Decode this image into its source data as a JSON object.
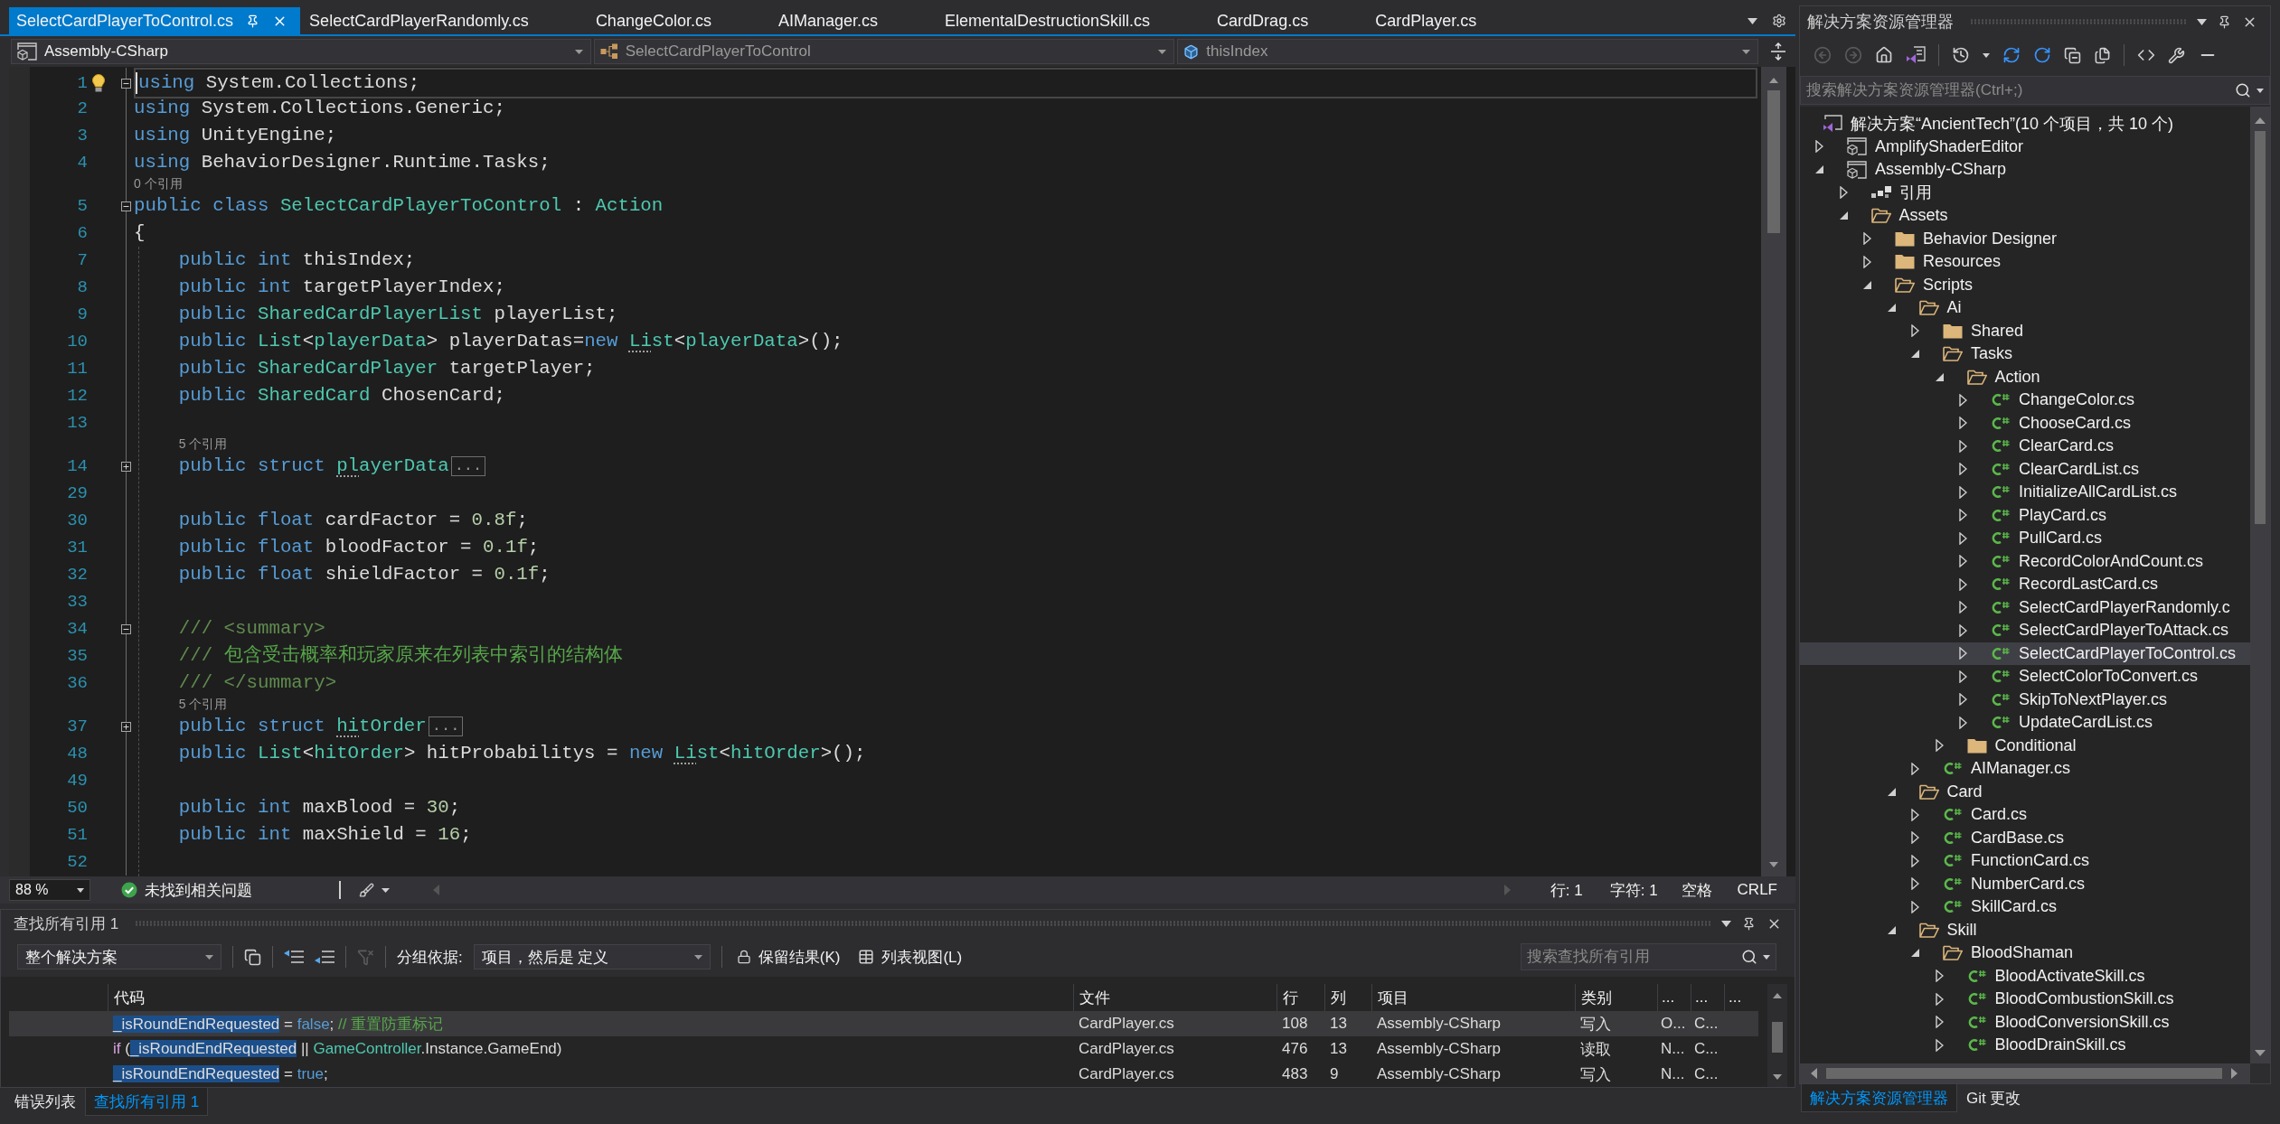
{
  "editor_tabs": [
    {
      "label": "SelectCardPlayerToControl.cs",
      "selected": true
    },
    {
      "label": "SelectCardPlayerRandomly.cs",
      "selected": false
    },
    {
      "label": "ChangeColor.cs",
      "selected": false
    },
    {
      "label": "AIManager.cs",
      "selected": false
    },
    {
      "label": "ElementalDestructionSkill.cs",
      "selected": false
    },
    {
      "label": "CardDrag.cs",
      "selected": false
    },
    {
      "label": "CardPlayer.cs",
      "selected": false
    }
  ],
  "nav_bar": {
    "project": "Assembly-CSharp",
    "type": "SelectCardPlayerToControl",
    "member": "thisIndex"
  },
  "editor": {
    "lines": [
      {
        "number": "1",
        "current": true,
        "folded": false,
        "tokens": [
          {
            "text": "using",
            "kind": "keyword"
          },
          {
            "text": " System.Collections;",
            "kind": "plain"
          }
        ]
      },
      {
        "number": "2",
        "current": false,
        "tokens": [
          {
            "text": "using",
            "kind": "keyword"
          },
          {
            "text": " System.Collections.Generic;",
            "kind": "plain"
          }
        ]
      },
      {
        "number": "3",
        "current": false,
        "tokens": [
          {
            "text": "using",
            "kind": "keyword"
          },
          {
            "text": " UnityEngine;",
            "kind": "plain"
          }
        ]
      },
      {
        "number": "4",
        "current": false,
        "tokens": [
          {
            "text": "using",
            "kind": "keyword"
          },
          {
            "text": " BehaviorDesigner.Runtime.Tasks;",
            "kind": "plain"
          }
        ]
      },
      {
        "number": "5",
        "current": false,
        "folded": false,
        "codelens": "0 个引用",
        "tokens": [
          {
            "text": "public class ",
            "kind": "keyword"
          },
          {
            "text": "SelectCardPlayerToControl",
            "kind": "type"
          },
          {
            "text": " : ",
            "kind": "plain"
          },
          {
            "text": "Action",
            "kind": "type"
          }
        ]
      },
      {
        "number": "6",
        "current": false,
        "tokens": [
          {
            "text": "{",
            "kind": "plain"
          }
        ]
      },
      {
        "number": "7",
        "current": false,
        "tokens": [
          {
            "text": "    public int ",
            "kind": "keyword"
          },
          {
            "text": "thisIndex;",
            "kind": "plain"
          }
        ]
      },
      {
        "number": "8",
        "current": false,
        "tokens": [
          {
            "text": "    public int ",
            "kind": "keyword"
          },
          {
            "text": "targetPlayerIndex;",
            "kind": "plain"
          }
        ]
      },
      {
        "number": "9",
        "current": false,
        "tokens": [
          {
            "text": "    public ",
            "kind": "keyword"
          },
          {
            "text": "SharedCardPlayerList",
            "kind": "type"
          },
          {
            "text": " playerList;",
            "kind": "plain"
          }
        ]
      },
      {
        "number": "10",
        "current": false,
        "tokens": [
          {
            "text": "    public ",
            "kind": "keyword"
          },
          {
            "text": "List",
            "kind": "type"
          },
          {
            "text": "<",
            "kind": "plain"
          },
          {
            "text": "playerData",
            "kind": "type"
          },
          {
            "text": "> playerDatas=",
            "kind": "plain"
          },
          {
            "text": "new ",
            "kind": "keyword"
          },
          {
            "text": "Li",
            "kind": "type",
            "hint": true
          },
          {
            "text": "st",
            "kind": "type"
          },
          {
            "text": "<",
            "kind": "plain"
          },
          {
            "text": "playerData",
            "kind": "type"
          },
          {
            "text": ">();",
            "kind": "plain"
          }
        ]
      },
      {
        "number": "11",
        "current": false,
        "tokens": [
          {
            "text": "    public ",
            "kind": "keyword"
          },
          {
            "text": "SharedCardPlayer",
            "kind": "type"
          },
          {
            "text": " targetPlayer;",
            "kind": "plain"
          }
        ]
      },
      {
        "number": "12",
        "current": false,
        "tokens": [
          {
            "text": "    public ",
            "kind": "keyword"
          },
          {
            "text": "SharedCard",
            "kind": "type"
          },
          {
            "text": " ChosenCard;",
            "kind": "plain"
          }
        ]
      },
      {
        "number": "13",
        "current": false
      },
      {
        "number": "14",
        "current": false,
        "folded": true,
        "codelens": "5 个引用",
        "tokens": [
          {
            "text": "    public struct ",
            "kind": "keyword"
          },
          {
            "text": "pl",
            "kind": "type",
            "hint": true
          },
          {
            "text": "ayerData",
            "kind": "type"
          }
        ],
        "collapsed_marker": "..."
      },
      {
        "number": "29",
        "current": false
      },
      {
        "number": "30",
        "current": false,
        "tokens": [
          {
            "text": "    public float ",
            "kind": "keyword"
          },
          {
            "text": "cardFactor = ",
            "kind": "plain"
          },
          {
            "text": "0.8f",
            "kind": "number"
          },
          {
            "text": ";",
            "kind": "plain"
          }
        ]
      },
      {
        "number": "31",
        "current": false,
        "tokens": [
          {
            "text": "    public float ",
            "kind": "keyword"
          },
          {
            "text": "bloodFactor = ",
            "kind": "plain"
          },
          {
            "text": "0.1f",
            "kind": "number"
          },
          {
            "text": ";",
            "kind": "plain"
          }
        ]
      },
      {
        "number": "32",
        "current": false,
        "tokens": [
          {
            "text": "    public float ",
            "kind": "keyword"
          },
          {
            "text": "shieldFactor = ",
            "kind": "plain"
          },
          {
            "text": "0.1f",
            "kind": "number"
          },
          {
            "text": ";",
            "kind": "plain"
          }
        ]
      },
      {
        "number": "33",
        "current": false
      },
      {
        "number": "34",
        "current": false,
        "folded": false,
        "tokens": [
          {
            "text": "    /// <summary>",
            "kind": "doc"
          }
        ]
      },
      {
        "number": "35",
        "current": false,
        "tokens": [
          {
            "text": "    /// ",
            "kind": "doc"
          },
          {
            "text": "包含受击概率和玩家原来在列表中索引的结构体",
            "kind": "comment"
          }
        ]
      },
      {
        "number": "36",
        "current": false,
        "tokens": [
          {
            "text": "    /// </summary>",
            "kind": "doc"
          }
        ]
      },
      {
        "number": "37",
        "current": false,
        "folded": true,
        "codelens": "5 个引用",
        "tokens": [
          {
            "text": "    public struct ",
            "kind": "keyword"
          },
          {
            "text": "hi",
            "kind": "type",
            "hint": true
          },
          {
            "text": "tOrder",
            "kind": "type"
          }
        ],
        "collapsed_marker": "..."
      },
      {
        "number": "48",
        "current": false,
        "tokens": [
          {
            "text": "    public ",
            "kind": "keyword"
          },
          {
            "text": "List",
            "kind": "type"
          },
          {
            "text": "<",
            "kind": "plain"
          },
          {
            "text": "hitOrder",
            "kind": "type"
          },
          {
            "text": "> hitProbabilitys = ",
            "kind": "plain"
          },
          {
            "text": "new ",
            "kind": "keyword"
          },
          {
            "text": "Li",
            "kind": "type",
            "hint": true
          },
          {
            "text": "st",
            "kind": "type"
          },
          {
            "text": "<",
            "kind": "plain"
          },
          {
            "text": "hitOrder",
            "kind": "type"
          },
          {
            "text": ">();",
            "kind": "plain"
          }
        ]
      },
      {
        "number": "49",
        "current": false
      },
      {
        "number": "50",
        "current": false,
        "tokens": [
          {
            "text": "    public int ",
            "kind": "keyword"
          },
          {
            "text": "maxBlood = ",
            "kind": "plain"
          },
          {
            "text": "30",
            "kind": "number"
          },
          {
            "text": ";",
            "kind": "plain"
          }
        ]
      },
      {
        "number": "51",
        "current": false,
        "tokens": [
          {
            "text": "    public int ",
            "kind": "keyword"
          },
          {
            "text": "maxShield = ",
            "kind": "plain"
          },
          {
            "text": "16",
            "kind": "number"
          },
          {
            "text": ";",
            "kind": "plain"
          }
        ]
      },
      {
        "number": "52",
        "current": false
      }
    ]
  },
  "editor_status": {
    "zoom": "88 %",
    "issues": "未找到相关问题",
    "line": "行: 1",
    "column": "字符: 1",
    "indent": "空格",
    "line_ending": "CRLF"
  },
  "find_panel": {
    "title": "查找所有引用 1",
    "scope": "整个解决方案",
    "group_label": "分组依据:",
    "group_value": "项目，然后是 定义",
    "keep_results": "保留结果(K)",
    "list_view": "列表视图(L)",
    "search": {
      "placeholder": "搜索查找所有引用"
    },
    "columns": [
      "代码",
      "文件",
      "行",
      "列",
      "项目",
      "类别",
      "...",
      "...",
      "..."
    ],
    "rows": [
      {
        "selected": true,
        "cells": [
          {
            "tokens": [
              {
                "text": "_isRoundEndRequested",
                "kind": "match"
              },
              {
                "text": " = ",
                "kind": "plain"
              },
              {
                "text": "false",
                "kind": "keyword"
              },
              {
                "text": "; ",
                "kind": "plain"
              },
              {
                "text": "// 重置防重标记",
                "kind": "comment"
              }
            ]
          },
          "CardPlayer.cs",
          "108",
          "13",
          "Assembly-CSharp",
          "写入",
          "O...",
          "C..."
        ]
      },
      {
        "selected": false,
        "cells": [
          {
            "tokens": [
              {
                "text": "if",
                "kind": "control"
              },
              {
                "text": " (",
                "kind": "plain"
              },
              {
                "text": "_isRoundEndRequested",
                "kind": "match"
              },
              {
                "text": " || ",
                "kind": "plain"
              },
              {
                "text": "GameController",
                "kind": "type"
              },
              {
                "text": ".Instance.GameEnd)",
                "kind": "plain"
              }
            ]
          },
          "CardPlayer.cs",
          "476",
          "13",
          "Assembly-CSharp",
          "读取",
          "N...",
          "C..."
        ]
      },
      {
        "selected": false,
        "cells": [
          {
            "tokens": [
              {
                "text": "_isRoundEndRequested",
                "kind": "match"
              },
              {
                "text": " = ",
                "kind": "plain"
              },
              {
                "text": "true",
                "kind": "keyword"
              },
              {
                "text": ";",
                "kind": "plain"
              }
            ]
          },
          "CardPlayer.cs",
          "483",
          "9",
          "Assembly-CSharp",
          "写入",
          "N...",
          "C..."
        ]
      }
    ]
  },
  "bottom_tabs": [
    {
      "label": "错误列表",
      "selected": false
    },
    {
      "label": "查找所有引用 1",
      "selected": true
    }
  ],
  "solution_explorer": {
    "title": "解决方案资源管理器",
    "search": {
      "placeholder": "搜索解决方案资源管理器(Ctrl+;)"
    },
    "solution": {
      "label": "解决方案“AncientTech”(10 个项目，共 10 个)",
      "children": [
        {
          "label": "AmplifyShaderEditor",
          "kind": "project",
          "expanded": false,
          "selected": false
        },
        {
          "label": "Assembly-CSharp",
          "kind": "project",
          "expanded": true,
          "selected": false,
          "children": [
            {
              "label": "引用",
              "kind": "references",
              "expanded": false,
              "selected": false
            },
            {
              "label": "Assets",
              "kind": "folder",
              "expanded": true,
              "selected": false,
              "children": [
                {
                  "label": "Behavior Designer",
                  "kind": "folder",
                  "expanded": false,
                  "selected": false
                },
                {
                  "label": "Resources",
                  "kind": "folder",
                  "expanded": false,
                  "selected": false
                },
                {
                  "label": "Scripts",
                  "kind": "folder",
                  "expanded": true,
                  "selected": false,
                  "children": [
                    {
                      "label": "Ai",
                      "kind": "folder",
                      "expanded": true,
                      "selected": false,
                      "children": [
                        {
                          "label": "Shared",
                          "kind": "folder",
                          "expanded": false,
                          "selected": false
                        },
                        {
                          "label": "Tasks",
                          "kind": "folder",
                          "expanded": true,
                          "selected": false,
                          "children": [
                            {
                              "label": "Action",
                              "kind": "folder",
                              "expanded": true,
                              "selected": false,
                              "children": [
                                {
                                  "label": "ChangeColor.cs",
                                  "kind": "csfile",
                                  "expanded": false,
                                  "selected": false
                                },
                                {
                                  "label": "ChooseCard.cs",
                                  "kind": "csfile",
                                  "expanded": false,
                                  "selected": false
                                },
                                {
                                  "label": "ClearCard.cs",
                                  "kind": "csfile",
                                  "expanded": false,
                                  "selected": false
                                },
                                {
                                  "label": "ClearCardList.cs",
                                  "kind": "csfile",
                                  "expanded": false,
                                  "selected": false
                                },
                                {
                                  "label": "InitializeAllCardList.cs",
                                  "kind": "csfile",
                                  "expanded": false,
                                  "selected": false
                                },
                                {
                                  "label": "PlayCard.cs",
                                  "kind": "csfile",
                                  "expanded": false,
                                  "selected": false
                                },
                                {
                                  "label": "PullCard.cs",
                                  "kind": "csfile",
                                  "expanded": false,
                                  "selected": false
                                },
                                {
                                  "label": "RecordColorAndCount.cs",
                                  "kind": "csfile",
                                  "expanded": false,
                                  "selected": false
                                },
                                {
                                  "label": "RecordLastCard.cs",
                                  "kind": "csfile",
                                  "expanded": false,
                                  "selected": false
                                },
                                {
                                  "label": "SelectCardPlayerRandomly.c",
                                  "kind": "csfile",
                                  "expanded": false,
                                  "selected": false
                                },
                                {
                                  "label": "SelectCardPlayerToAttack.cs",
                                  "kind": "csfile",
                                  "expanded": false,
                                  "selected": false
                                },
                                {
                                  "label": "SelectCardPlayerToControl.cs",
                                  "kind": "csfile",
                                  "expanded": false,
                                  "selected": true
                                },
                                {
                                  "label": "SelectColorToConvert.cs",
                                  "kind": "csfile",
                                  "expanded": false,
                                  "selected": false
                                },
                                {
                                  "label": "SkipToNextPlayer.cs",
                                  "kind": "csfile",
                                  "expanded": false,
                                  "selected": false
                                },
                                {
                                  "label": "UpdateCardList.cs",
                                  "kind": "csfile",
                                  "expanded": false,
                                  "selected": false
                                }
                              ]
                            },
                            {
                              "label": "Conditional",
                              "kind": "folder",
                              "expanded": false,
                              "selected": false
                            }
                          ]
                        },
                        {
                          "label": "AIManager.cs",
                          "kind": "csfile",
                          "expanded": false,
                          "selected": false
                        }
                      ]
                    },
                    {
                      "label": "Card",
                      "kind": "folder",
                      "expanded": true,
                      "selected": false,
                      "children": [
                        {
                          "label": "Card.cs",
                          "kind": "csfile",
                          "expanded": false,
                          "selected": false
                        },
                        {
                          "label": "CardBase.cs",
                          "kind": "csfile",
                          "expanded": false,
                          "selected": false
                        },
                        {
                          "label": "FunctionCard.cs",
                          "kind": "csfile",
                          "expanded": false,
                          "selected": false
                        },
                        {
                          "label": "NumberCard.cs",
                          "kind": "csfile",
                          "expanded": false,
                          "selected": false
                        },
                        {
                          "label": "SkillCard.cs",
                          "kind": "csfile",
                          "expanded": false,
                          "selected": false
                        }
                      ]
                    },
                    {
                      "label": "Skill",
                      "kind": "folder",
                      "expanded": true,
                      "selected": false,
                      "children": [
                        {
                          "label": "BloodShaman",
                          "kind": "folder",
                          "expanded": true,
                          "selected": false,
                          "children": [
                            {
                              "label": "BloodActivateSkill.cs",
                              "kind": "csfile",
                              "expanded": false,
                              "selected": false
                            },
                            {
                              "label": "BloodCombustionSkill.cs",
                              "kind": "csfile",
                              "expanded": false,
                              "selected": false
                            },
                            {
                              "label": "BloodConversionSkill.cs",
                              "kind": "csfile",
                              "expanded": false,
                              "selected": false
                            },
                            {
                              "label": "BloodDrainSkill.cs",
                              "kind": "csfile",
                              "expanded": false,
                              "selected": false
                            }
                          ]
                        }
                      ]
                    }
                  ]
                }
              ]
            }
          ]
        }
      ]
    },
    "tabs": [
      {
        "label": "解决方案资源管理器",
        "selected": true
      },
      {
        "label": "Git 更改",
        "selected": false
      }
    ]
  }
}
